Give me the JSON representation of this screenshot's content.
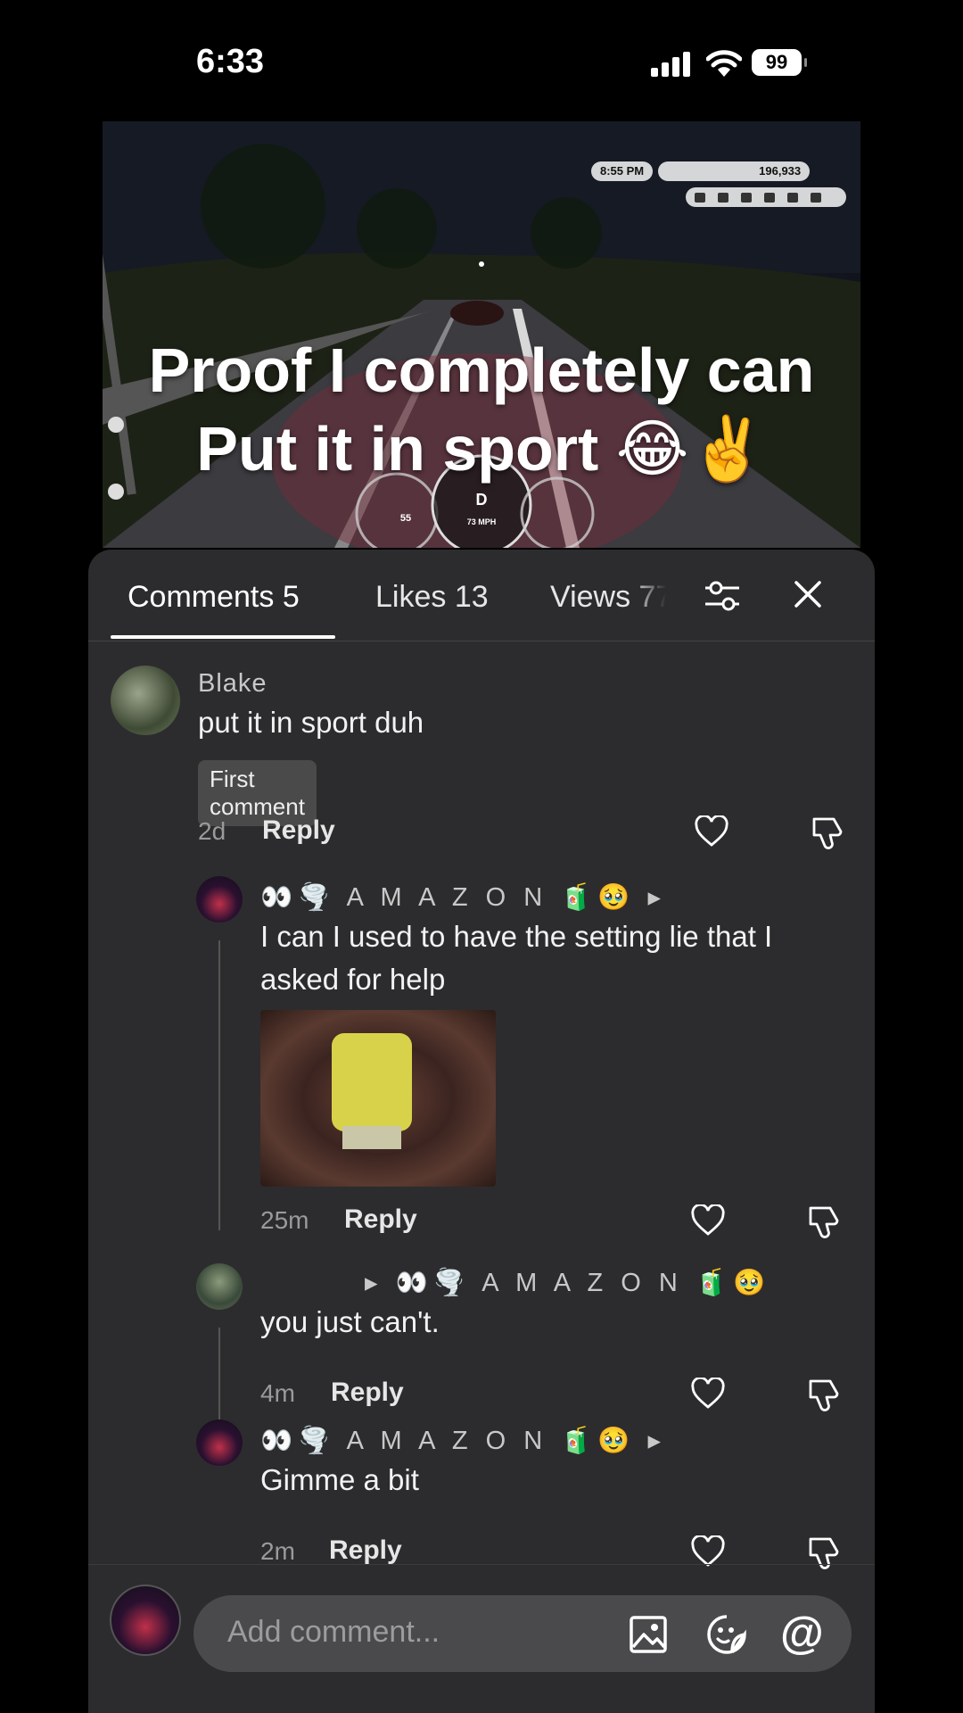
{
  "status": {
    "time": "6:33",
    "battery": "99"
  },
  "video": {
    "caption_line1": "Proof I completely can",
    "caption_line2": "Put it in sport 😂✌️",
    "hud_time": "8:55 PM",
    "hud_cash": "196,933",
    "hud_gear": "D",
    "hud_speed": "73 MPH",
    "hud_limit": "55"
  },
  "tabs": [
    {
      "label": "Comments 5"
    },
    {
      "label": "Likes 13"
    },
    {
      "label": "Views 77"
    }
  ],
  "comments": [
    {
      "user": "Blake",
      "text": "put it in sport duh",
      "badge": "First comment",
      "time": "2d",
      "reply": "Reply"
    },
    {
      "user": "👀🌪️ A M A Z O N 🧃🥹 ▸",
      "text": "I can I used to have the setting lie that I asked for help",
      "time": "25m",
      "reply": "Reply"
    },
    {
      "user": "▸ 👀🌪️ A M A Z O N 🧃🥹",
      "text": "you just can't.",
      "time": "4m",
      "reply": "Reply"
    },
    {
      "user": "👀🌪️ A M A Z O N 🧃🥹 ▸",
      "text": "Gimme a bit",
      "time": "2m",
      "reply": "Reply"
    }
  ],
  "input": {
    "placeholder": "Add comment..."
  }
}
